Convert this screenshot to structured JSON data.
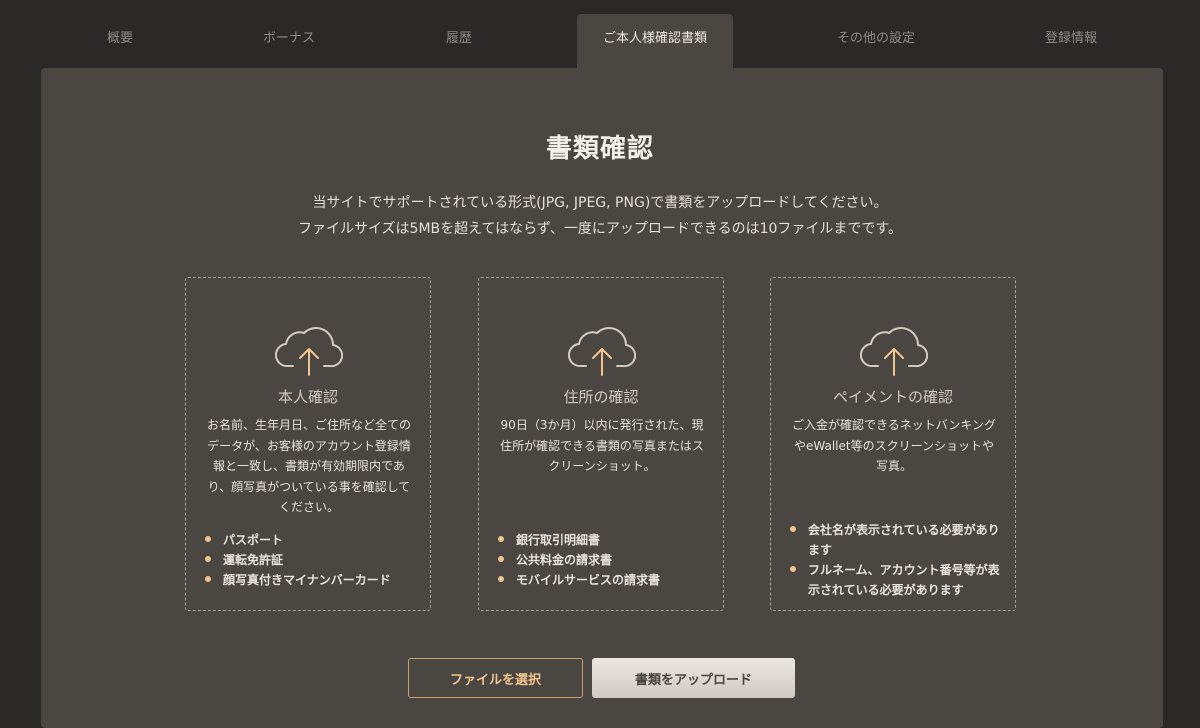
{
  "tabs": [
    {
      "label": "概要"
    },
    {
      "label": "ボーナス"
    },
    {
      "label": "履歴"
    },
    {
      "label": "ご本人様確認書類",
      "active": true
    },
    {
      "label": "その他の設定"
    },
    {
      "label": "登録情報"
    }
  ],
  "main": {
    "title": "書類確認",
    "description_line1": "当サイトでサポートされている形式(JPG, JPEG, PNG)で書類をアップロードしてください。",
    "description_line2": "ファイルサイズは5MBを超えてはならず、一度にアップロードできるのは10ファイルまでです。"
  },
  "cards": [
    {
      "icon": "cloud-upload-icon",
      "title": "本人確認",
      "text": "お名前、生年月日、ご住所など全てのデータが、お客様のアカウント登録情報と一致し、書類が有効期限内であり、顔写真がついている事を確認してください。",
      "items": [
        "パスポート",
        "運転免許証",
        "顔写真付きマイナンバーカード"
      ]
    },
    {
      "icon": "cloud-upload-icon",
      "title": "住所の確認",
      "text": "90日（3か月）以内に発行された、現住所が確認できる書類の写真またはスクリーンショット。",
      "items": [
        "銀行取引明細書",
        "公共料金の請求書",
        "モバイルサービスの請求書"
      ]
    },
    {
      "icon": "cloud-upload-icon",
      "title": "ペイメントの確認",
      "text": "ご入金が確認できるネットバンキングやeWallet等のスクリーンショットや写真。",
      "items": [
        "会社名が表示されている必要があります",
        "フルネーム、アカウント番号等が表示されている必要があります"
      ]
    }
  ],
  "buttons": {
    "select_label": "ファイルを選択",
    "upload_label": "書類をアップロード"
  },
  "colors": {
    "background": "#2b2928",
    "panel": "#4a4641",
    "accent": "#f3c48e"
  }
}
